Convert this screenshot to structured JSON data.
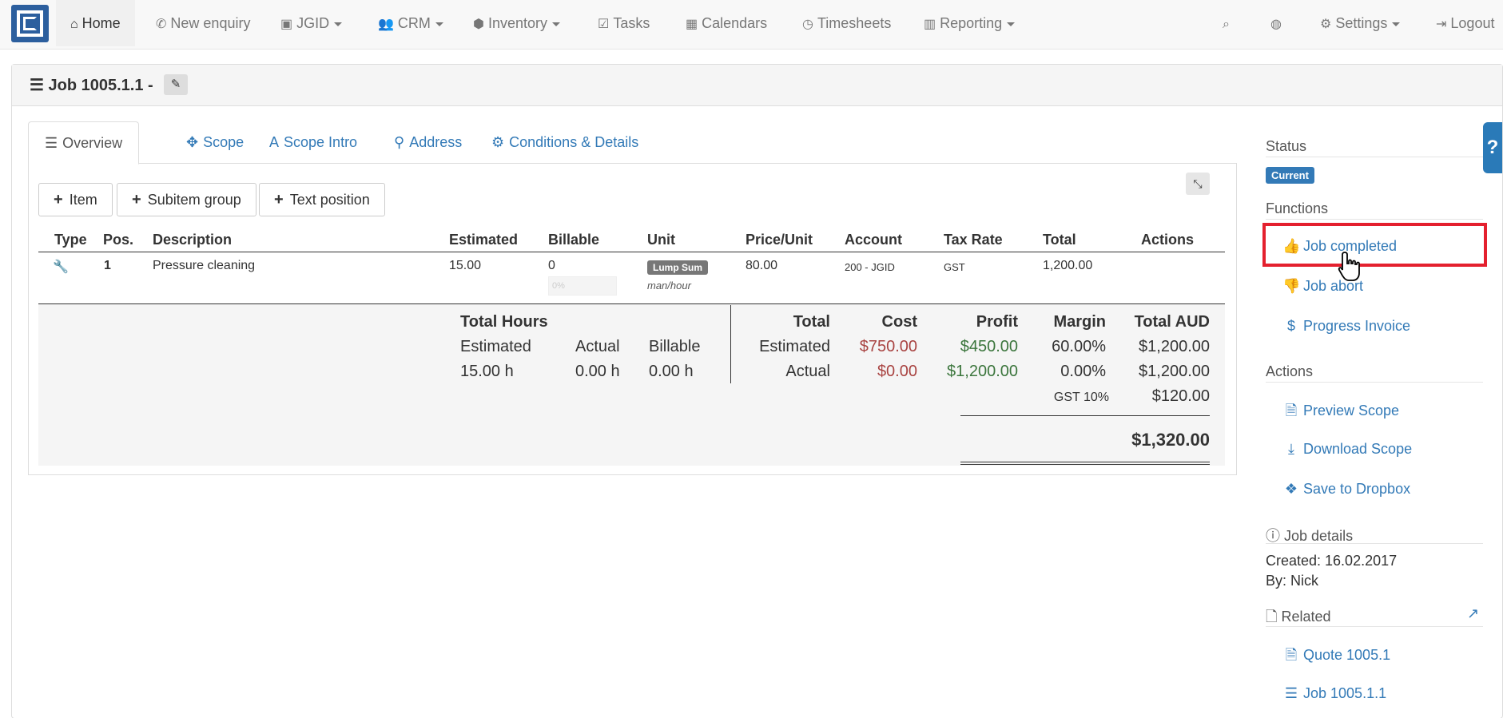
{
  "nav": {
    "home": "Home",
    "new_enquiry": "New enquiry",
    "jgid": "JGID",
    "crm": "CRM",
    "inventory": "Inventory",
    "tasks": "Tasks",
    "calendars": "Calendars",
    "timesheets": "Timesheets",
    "reporting": "Reporting",
    "settings": "Settings",
    "logout": "Logout"
  },
  "page": {
    "title": "Job 1005.1.1 -"
  },
  "tabs": [
    "Overview",
    "Scope",
    "Scope Intro",
    "Address",
    "Conditions & Details"
  ],
  "toolbar": {
    "item": "Item",
    "subitem_group": "Subitem group",
    "text_position": "Text position"
  },
  "table": {
    "headers": [
      "Type",
      "Pos.",
      "Description",
      "Estimated",
      "Billable",
      "Unit",
      "Price/Unit",
      "Account",
      "Tax Rate",
      "Total",
      "Actions"
    ],
    "row": {
      "pos": "1",
      "description": "Pressure cleaning",
      "estimated": "15.00",
      "billable": "0",
      "billable_pct": "0%",
      "unit_badge": "Lump Sum",
      "unit_sub": "man/hour",
      "price": "80.00",
      "account": "200 - JGID",
      "tax": "GST",
      "total": "1,200.00"
    }
  },
  "summary": {
    "hours_title": "Total Hours",
    "hours_headers": [
      "Estimated",
      "Actual",
      "Billable"
    ],
    "hours_values": [
      "15.00 h",
      "0.00 h",
      "0.00 h"
    ],
    "money_headers": [
      "Total",
      "Cost",
      "Profit",
      "Margin",
      "Total AUD"
    ],
    "estimated": {
      "label": "Estimated",
      "cost": "$750.00",
      "profit": "$450.00",
      "margin": "60.00%",
      "total": "$1,200.00"
    },
    "actual": {
      "label": "Actual",
      "cost": "$0.00",
      "profit": "$1,200.00",
      "margin": "0.00%",
      "total": "$1,200.00"
    },
    "gst_label": "GST 10%",
    "gst_value": "$120.00",
    "grand_total": "$1,320.00"
  },
  "sidebar": {
    "status_title": "Status",
    "status_badge": "Current",
    "functions_title": "Functions",
    "job_completed": "Job completed",
    "job_abort": "Job abort",
    "progress_invoice": "Progress Invoice",
    "actions_title": "Actions",
    "preview_scope": "Preview Scope",
    "download_scope": "Download Scope",
    "save_dropbox": "Save to Dropbox",
    "job_details_title": "Job details",
    "created": "Created: 16.02.2017",
    "by": "By: Nick",
    "related_title": "Related",
    "quote_link": "Quote 1005.1",
    "job_link": "Job 1005.1.1"
  },
  "colors": {
    "link": "#337ab7",
    "highlight": "#e4202e",
    "cost": "#a94442",
    "profit": "#3c763d"
  }
}
